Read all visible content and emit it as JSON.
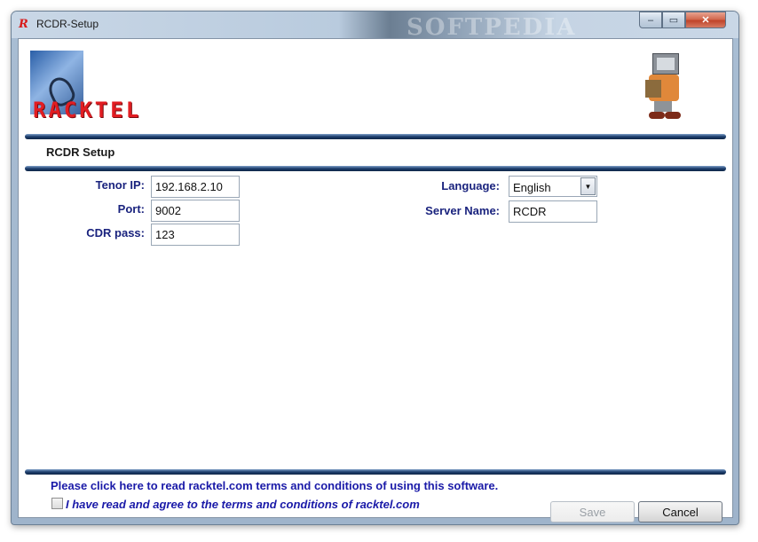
{
  "window": {
    "title": "RCDR-Setup",
    "app_icon": "R",
    "watermark": "SOFTPEDIA",
    "controls": {
      "minimize": "–",
      "maximize": "▭",
      "close": "✕"
    }
  },
  "header": {
    "logo_text": "RACKTEL",
    "section_title": "RCDR Setup"
  },
  "form": {
    "tenor_ip": {
      "label": "Tenor IP:",
      "value": "192.168.2.10"
    },
    "port": {
      "label": "Port:",
      "value": "9002"
    },
    "cdr_pass": {
      "label": "CDR pass:",
      "value": "123"
    },
    "language": {
      "label": "Language:",
      "value": "English"
    },
    "server_name": {
      "label": "Server Name:",
      "value": "RCDR"
    }
  },
  "footer": {
    "terms_link": "Please click here to read racktel.com terms and conditions of using this software.",
    "agree_label": "I have read and agree to the terms and conditions of racktel.com",
    "agree_checked": false,
    "save_label": "Save",
    "cancel_label": "Cancel"
  },
  "colors": {
    "label_color": "#1a237e",
    "link_color": "#1a1aa8",
    "rule_color": "#1e3f6e",
    "logo_red": "#e21d22"
  }
}
